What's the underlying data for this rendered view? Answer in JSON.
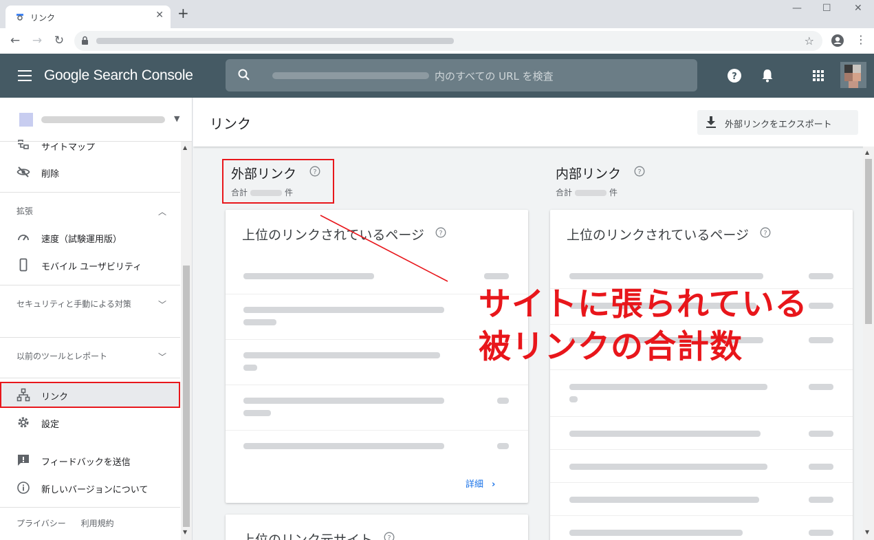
{
  "browser": {
    "tab_title": "リンク",
    "tab_close": "✕",
    "new_tab": "+",
    "window_minimize": "—",
    "window_maximize": "☐",
    "window_close": "✕",
    "back": "←",
    "forward": "→",
    "reload": "↻",
    "star": "☆",
    "menu": "⋮"
  },
  "header": {
    "app_name": "Google Search Console",
    "search_placeholder": "内のすべての URL を検査"
  },
  "sidebar": {
    "items_top": [
      {
        "label": "サイトマップ",
        "icon": "sitemap-icon"
      },
      {
        "label": "削除",
        "icon": "eye-off-icon"
      }
    ],
    "section_enhancements": "拡張",
    "enhancements_items": [
      {
        "label": "速度（試験運用版）",
        "icon": "speed-icon"
      },
      {
        "label": "モバイル ユーザビリティ",
        "icon": "mobile-icon"
      }
    ],
    "section_security": "セキュリティと手動による対策",
    "section_legacy": "以前のツールとレポート",
    "link_item": "リンク",
    "settings_item": "設定",
    "feedback_item": "フィードバックを送信",
    "about_item": "新しいバージョンについて",
    "footer_privacy": "プライバシー",
    "footer_terms": "利用規約"
  },
  "main": {
    "page_title": "リンク",
    "export_button": "外部リンクをエクスポート",
    "external": {
      "title": "外部リンク",
      "total_prefix": "合計",
      "total_suffix": "件",
      "card1_title": "上位のリンクされているページ",
      "card2_title": "上位のリンク元サイト",
      "details": "詳細"
    },
    "internal": {
      "title": "内部リンク",
      "total_prefix": "合計",
      "total_suffix": "件",
      "card1_title": "上位のリンクされているページ"
    }
  },
  "annotation": {
    "line1": "サイトに張られている",
    "line2": "被リンクの合計数",
    "color": "#e8161b"
  },
  "colors": {
    "header_bg": "#455a64",
    "accent_link": "#1a73e8",
    "annotation_red": "#e8161b"
  }
}
